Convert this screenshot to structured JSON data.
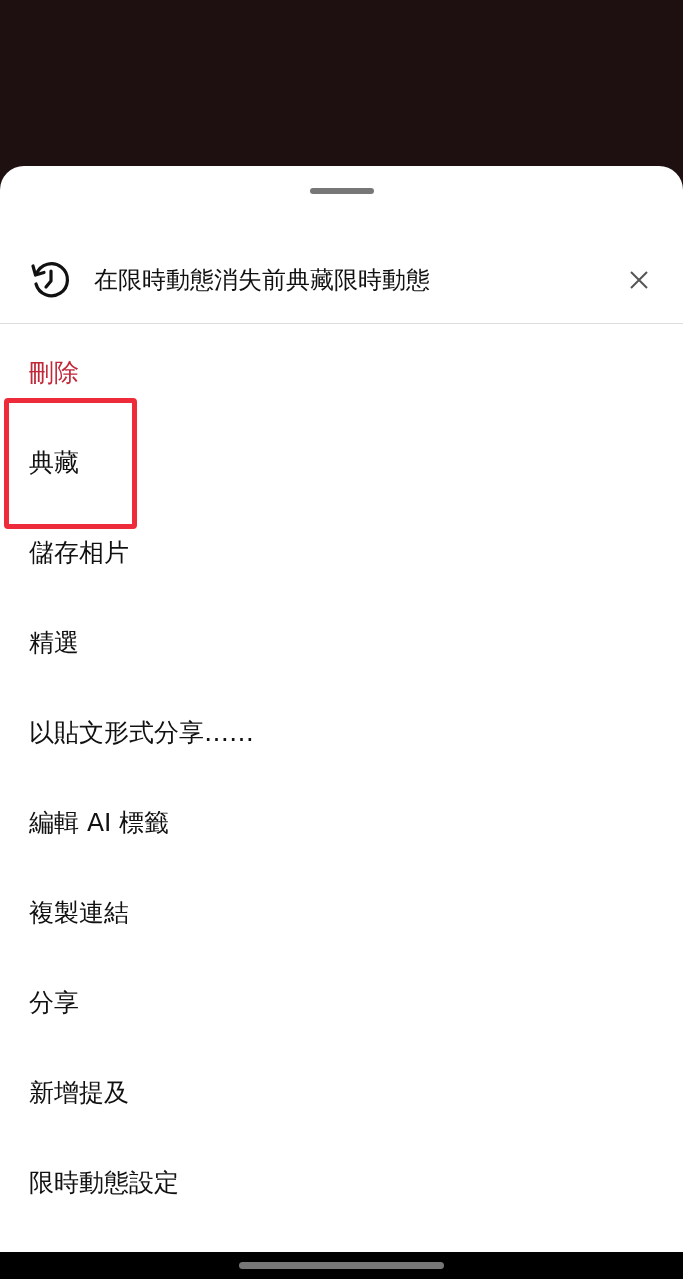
{
  "sheet": {
    "title": "在限時動態消失前典藏限時動態"
  },
  "actions": [
    {
      "label": "刪除",
      "kind": "destructive",
      "highlighted": false
    },
    {
      "label": "典藏",
      "kind": "normal",
      "highlighted": true
    },
    {
      "label": "儲存相片",
      "kind": "normal",
      "highlighted": false
    },
    {
      "label": "精選",
      "kind": "normal",
      "highlighted": false
    },
    {
      "label": "以貼文形式分享……",
      "kind": "normal",
      "highlighted": false
    },
    {
      "label": "編輯 AI 標籤",
      "kind": "normal",
      "highlighted": false
    },
    {
      "label": "複製連結",
      "kind": "normal",
      "highlighted": false
    },
    {
      "label": "分享",
      "kind": "normal",
      "highlighted": false
    },
    {
      "label": "新增提及",
      "kind": "normal",
      "highlighted": false
    },
    {
      "label": "限時動態設定",
      "kind": "normal",
      "highlighted": false
    }
  ]
}
